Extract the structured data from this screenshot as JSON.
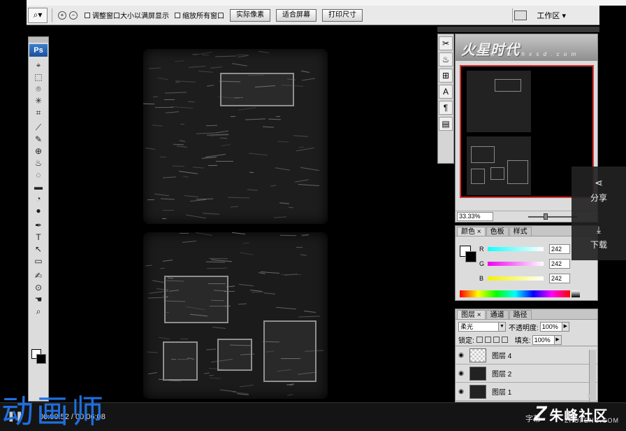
{
  "options_bar": {
    "zoom_in_symbol": "+",
    "zoom_out_symbol": "−",
    "resize_window_label": "调整窗口大小以满屏显示",
    "zoom_all_windows_label": "缩放所有窗口",
    "actual_pixels_label": "实际像素",
    "fit_screen_label": "适合屏幕",
    "print_size_label": "打印尺寸",
    "workspace_label": "工作区 ▾"
  },
  "tools": {
    "logo": "Ps",
    "items": [
      "⌖",
      "⬚",
      "⌾",
      "✳",
      "⌗",
      "⟋",
      "✎",
      "⊕",
      "♨",
      "◌",
      "▬",
      "◔",
      "●",
      "✒",
      "T",
      "↖",
      "▭",
      "✍",
      "⊙",
      "☚",
      "⌕"
    ]
  },
  "navigator": {
    "banner_logo": "火星时代",
    "banner_url": "w w w . h x s d . c o m",
    "zoom_value": "33.33%"
  },
  "color_panel": {
    "tabs": [
      "颜色 ×",
      "色板",
      "样式"
    ],
    "channels": [
      {
        "label": "R",
        "value": "242",
        "gradient": "linear-gradient(90deg,#0fffff,#ffffff)"
      },
      {
        "label": "G",
        "value": "242",
        "gradient": "linear-gradient(90deg,#f000f0,#ffffff)"
      },
      {
        "label": "B",
        "value": "242",
        "gradient": "linear-gradient(90deg,#f2f200,#ffffff)"
      }
    ]
  },
  "layers_panel": {
    "tabs": [
      "图层 ×",
      "通道",
      "路径"
    ],
    "blend_mode": "柔光",
    "opacity_label": "不透明度:",
    "opacity_value": "100%",
    "lock_label": "锁定:",
    "fill_label": "填充:",
    "fill_value": "100%",
    "layers": [
      {
        "name": "图层 4",
        "thumb": "checker"
      },
      {
        "name": "图层 2",
        "thumb": "dark"
      },
      {
        "name": "图层 1",
        "thumb": "dark"
      }
    ]
  },
  "side_actions": {
    "share_label": "分享",
    "download_label": "下载"
  },
  "player": {
    "time_display": "00:00:52 / 00:06:08",
    "subtitle_label": "字幕"
  },
  "branding": {
    "watermark": "动画师",
    "brand_name": "朱峰社区",
    "brand_url": "ZHUFENG.COM"
  }
}
